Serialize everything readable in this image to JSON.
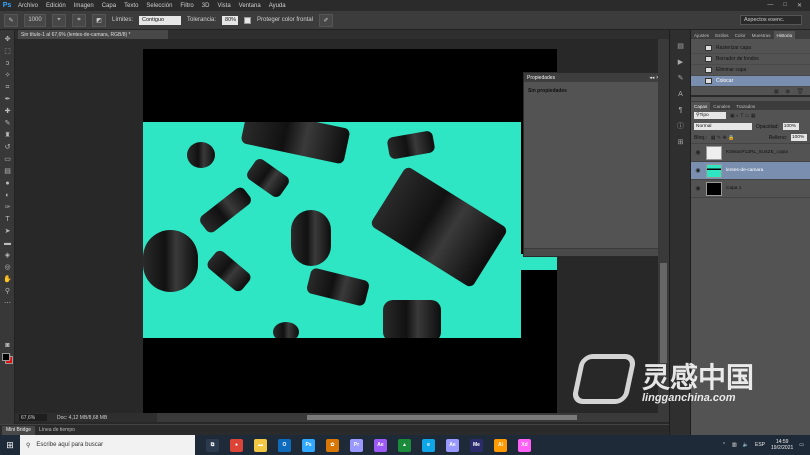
{
  "app": {
    "logo": "Ps",
    "menu": [
      "Archivo",
      "Edición",
      "Imagen",
      "Capa",
      "Texto",
      "Selección",
      "Filtro",
      "3D",
      "Vista",
      "Ventana",
      "Ayuda"
    ],
    "window_controls": [
      "—",
      "□",
      "✕"
    ]
  },
  "options_bar": {
    "tool_size": "1000",
    "limits_label": "Límites:",
    "limits_value": "Contiguo",
    "tolerance_label": "Tolerancia:",
    "tolerance_value": "80%",
    "protect_label": "Proteger color frontal",
    "workspace_value": "Aspectos esenc."
  },
  "document": {
    "tab_title": "Sin título-1 al 67,6% (lentes-de-camara, RGB/8) *"
  },
  "status_bar": {
    "zoom": "67,6%",
    "doc_size": "Doc: 4,12 MB/8,68 MB"
  },
  "bottom_tabs": [
    "Mini Bridge",
    "Línea de tiempo"
  ],
  "properties_panel": {
    "title": "Propiedades",
    "content": "Sin propiedades",
    "controls": "◂◂ ✕"
  },
  "right_panel": {
    "top_tabs": [
      "Ajustes",
      "Estilos",
      "Color",
      "Muestras",
      "Historia"
    ],
    "history": [
      {
        "label": "Rasterizar capa",
        "selected": false
      },
      {
        "label": "Borrador de fondos",
        "selected": false
      },
      {
        "label": "Eliminar capa",
        "selected": false
      },
      {
        "label": "Colocar",
        "selected": true
      }
    ],
    "layer_tabs": [
      "Capas",
      "Canales",
      "Trazados"
    ],
    "filter_label": "Tipo",
    "blend_mode": "Normal",
    "opacity_label": "Opacidad:",
    "opacity_value": "100%",
    "lock_label": "Bloq.:",
    "fill_label": "Relleno:",
    "fill_value": "100%",
    "layers": [
      {
        "name": "K5WanP13RL_5U4ZE_copia",
        "thumb": "smart",
        "selected": false
      },
      {
        "name": "lentes-de-camara",
        "thumb": "teal-t",
        "selected": true
      },
      {
        "name": "Capa 1",
        "thumb": "black",
        "selected": false
      }
    ]
  },
  "taskbar": {
    "search_placeholder": "Escribe aquí para buscar",
    "apps": [
      {
        "name": "Task View",
        "label": "⧉",
        "color": "#2b3a4d"
      },
      {
        "name": "Chrome",
        "label": "●",
        "color": "#db4437"
      },
      {
        "name": "Explorer",
        "label": "▬",
        "color": "#f2c744"
      },
      {
        "name": "Outlook",
        "label": "O",
        "color": "#0f6cbd"
      },
      {
        "name": "Photoshop",
        "label": "Ps",
        "color": "#31a8ff"
      },
      {
        "name": "Settings",
        "label": "✿",
        "color": "#d97706"
      },
      {
        "name": "Premiere",
        "label": "Pr",
        "color": "#9999ff"
      },
      {
        "name": "Ae",
        "label": "Ae",
        "color": "#9b59f5"
      },
      {
        "name": "App",
        "label": "▲",
        "color": "#1a8b3a"
      },
      {
        "name": "Edge",
        "label": "e",
        "color": "#0ea5e9"
      },
      {
        "name": "After Effects",
        "label": "Ae",
        "color": "#9999ff"
      },
      {
        "name": "Media Encoder",
        "label": "Me",
        "color": "#2c2c6c"
      },
      {
        "name": "Illustrator",
        "label": "Ai",
        "color": "#ff9a00"
      },
      {
        "name": "XD",
        "label": "Xd",
        "color": "#ff61f6"
      }
    ],
    "language": "ESP",
    "time": "14:59",
    "date": "19/2/2021"
  },
  "watermark": {
    "cn": "灵感中国",
    "en": "lingganchina.com"
  }
}
